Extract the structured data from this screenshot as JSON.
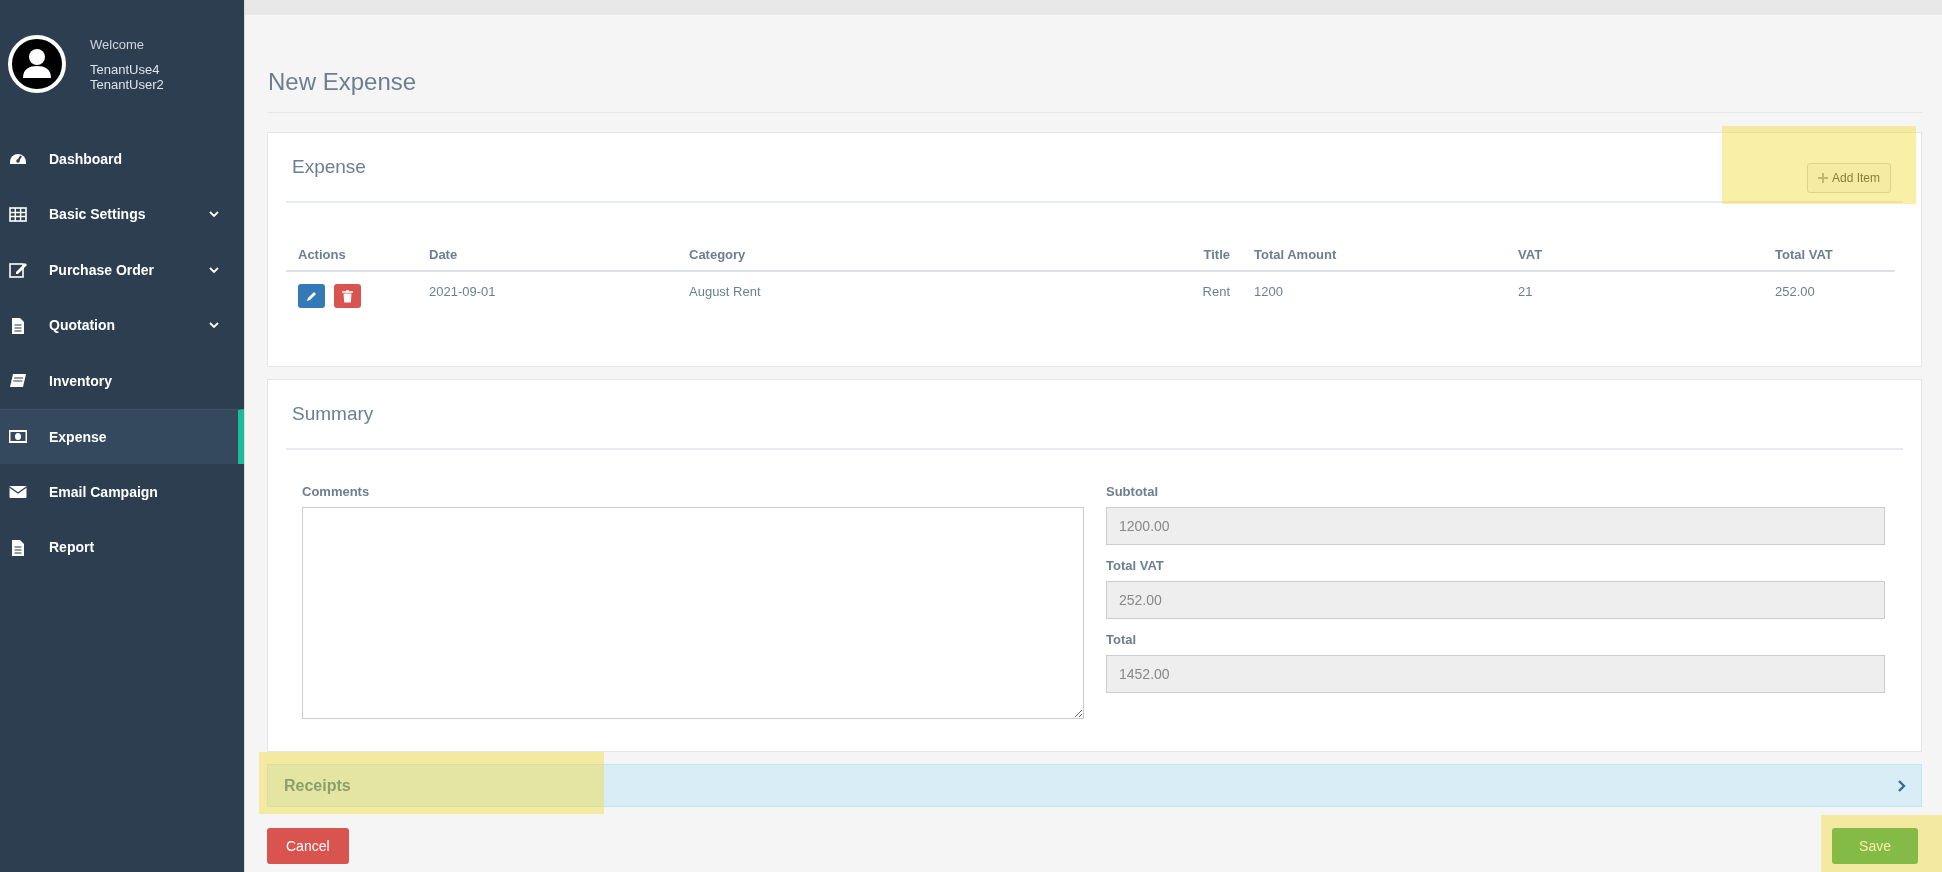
{
  "sidebar": {
    "welcome": "Welcome",
    "user_lines": [
      "TenantUse4",
      "TenantUser2"
    ],
    "items": [
      {
        "label": "Dashboard",
        "kind": "gauge",
        "expandable": false,
        "selected": false
      },
      {
        "label": "Basic Settings",
        "kind": "table",
        "expandable": true,
        "selected": false
      },
      {
        "label": "Purchase Order",
        "kind": "edit",
        "expandable": true,
        "selected": false
      },
      {
        "label": "Quotation",
        "kind": "file",
        "expandable": true,
        "selected": false
      },
      {
        "label": "Inventory",
        "kind": "book",
        "expandable": false,
        "selected": false
      },
      {
        "label": "Expense",
        "kind": "money",
        "expandable": false,
        "selected": true
      },
      {
        "label": "Email Campaign",
        "kind": "mail",
        "expandable": false,
        "selected": false
      },
      {
        "label": "Report",
        "kind": "file",
        "expandable": false,
        "selected": false
      }
    ]
  },
  "page_title": "New Expense",
  "expense": {
    "title": "Expense",
    "add_button": "Add Item",
    "columns": [
      "Actions",
      "Date",
      "Category",
      "Title",
      "Total Amount",
      "VAT",
      "Total VAT"
    ],
    "rows": [
      {
        "date": "2021-09-01",
        "category": "August Rent",
        "title": "Rent",
        "total_amount": "1200",
        "vat": "21",
        "total_vat": "252.00"
      }
    ]
  },
  "summary": {
    "title": "Summary",
    "comments_label": "Comments",
    "fields": [
      {
        "label": "Subtotal",
        "value": "1200.00"
      },
      {
        "label": "Total VAT",
        "value": "252.00"
      },
      {
        "label": "Total",
        "value": "1452.00"
      }
    ]
  },
  "receipts": {
    "title": "Receipts",
    "expanded": false
  },
  "buttons": {
    "cancel": "Cancel",
    "save": "Save"
  }
}
